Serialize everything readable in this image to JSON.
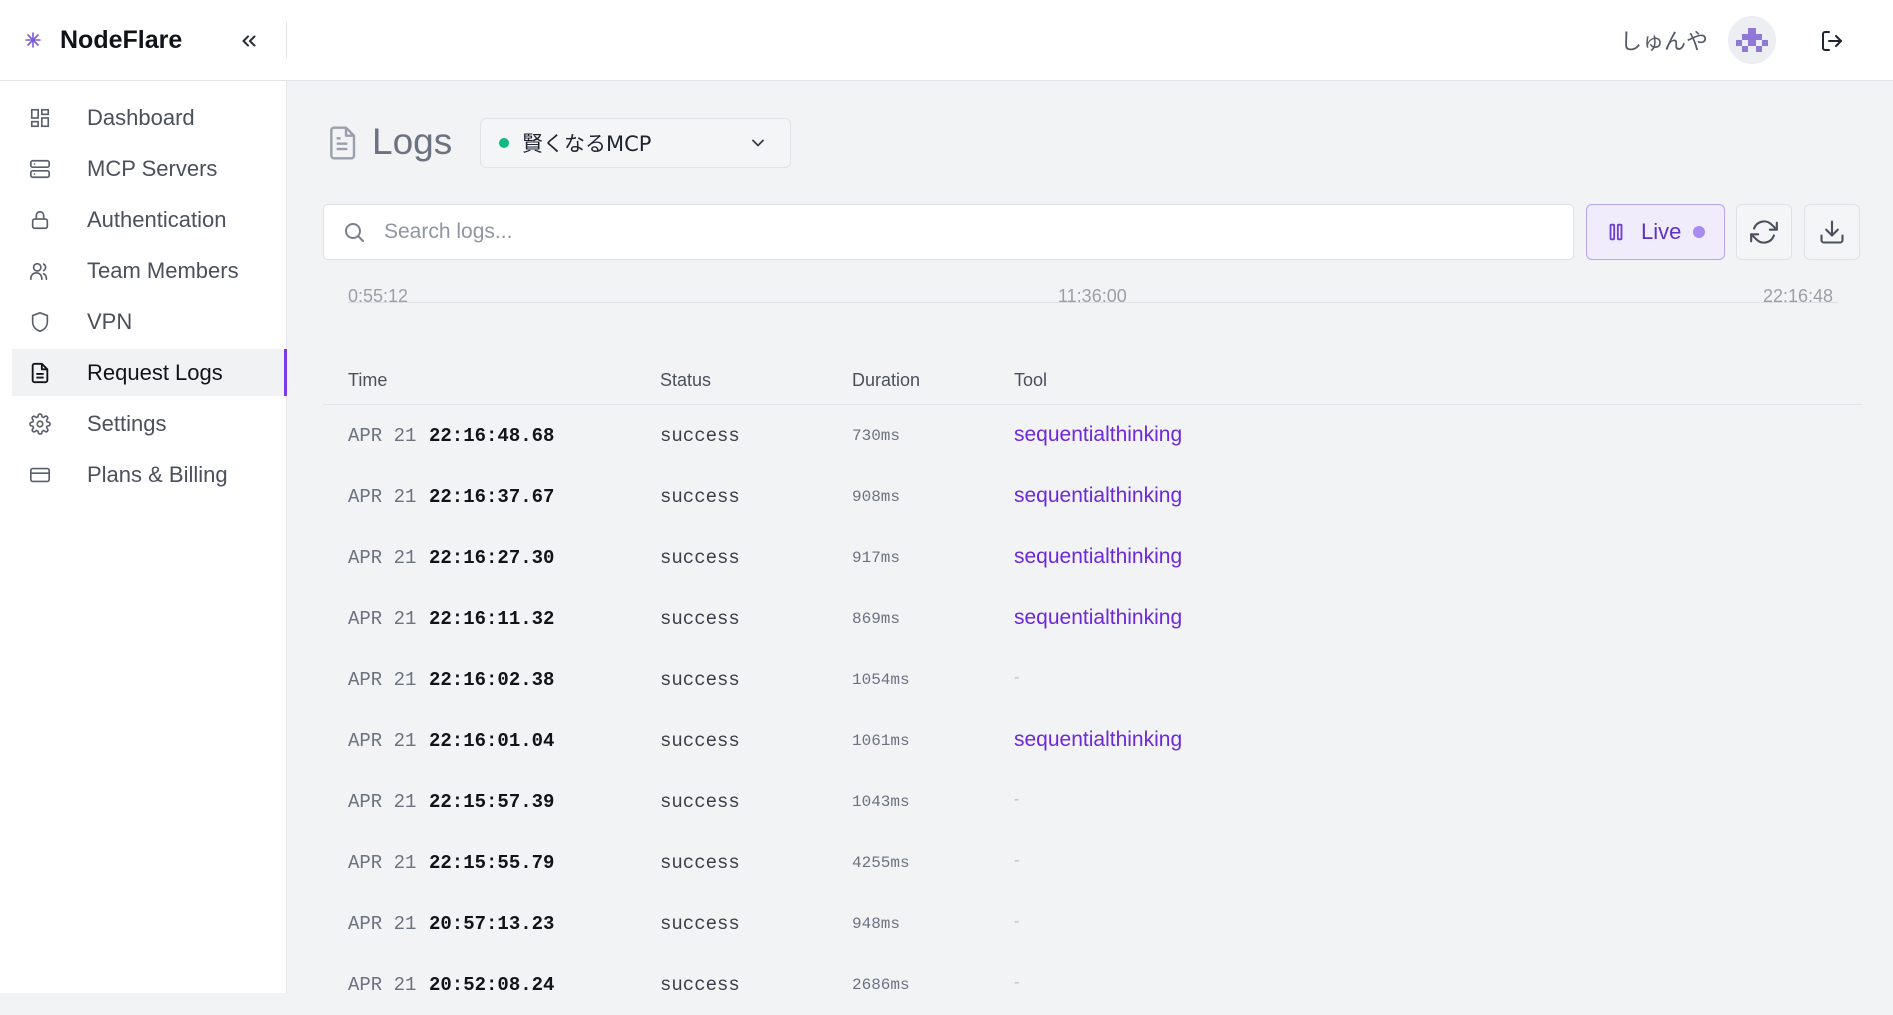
{
  "app": {
    "brand": "NodeFlare",
    "user_name": "しゅんや"
  },
  "sidebar": {
    "items": [
      {
        "label": "Dashboard",
        "icon": "dashboard-icon"
      },
      {
        "label": "MCP Servers",
        "icon": "server-icon"
      },
      {
        "label": "Authentication",
        "icon": "lock-icon"
      },
      {
        "label": "Team Members",
        "icon": "users-icon"
      },
      {
        "label": "VPN",
        "icon": "shield-icon"
      },
      {
        "label": "Request Logs",
        "icon": "file-text-icon",
        "active": true
      },
      {
        "label": "Settings",
        "icon": "gear-icon"
      },
      {
        "label": "Plans & Billing",
        "icon": "credit-card-icon"
      }
    ]
  },
  "page": {
    "title": "Logs",
    "server_selector": {
      "value": "賢くなるMCP",
      "status_color": "#10b981"
    }
  },
  "search": {
    "placeholder": "Search logs...",
    "value": ""
  },
  "live": {
    "label": "Live",
    "accent": "#7c3aed"
  },
  "timeline": {
    "start": "0:55:12",
    "mid": "11:36:00",
    "end": "22:16:48"
  },
  "table": {
    "headers": {
      "time": "Time",
      "status": "Status",
      "duration": "Duration",
      "tool": "Tool"
    },
    "rows": [
      {
        "date": "APR 21",
        "time": "22:16:48.68",
        "status": "success",
        "duration": "730ms",
        "tool": "sequentialthinking"
      },
      {
        "date": "APR 21",
        "time": "22:16:37.67",
        "status": "success",
        "duration": "908ms",
        "tool": "sequentialthinking"
      },
      {
        "date": "APR 21",
        "time": "22:16:27.30",
        "status": "success",
        "duration": "917ms",
        "tool": "sequentialthinking"
      },
      {
        "date": "APR 21",
        "time": "22:16:11.32",
        "status": "success",
        "duration": "869ms",
        "tool": "sequentialthinking"
      },
      {
        "date": "APR 21",
        "time": "22:16:02.38",
        "status": "success",
        "duration": "1054ms",
        "tool": "-"
      },
      {
        "date": "APR 21",
        "time": "22:16:01.04",
        "status": "success",
        "duration": "1061ms",
        "tool": "sequentialthinking"
      },
      {
        "date": "APR 21",
        "time": "22:15:57.39",
        "status": "success",
        "duration": "1043ms",
        "tool": "-"
      },
      {
        "date": "APR 21",
        "time": "22:15:55.79",
        "status": "success",
        "duration": "4255ms",
        "tool": "-"
      },
      {
        "date": "APR 21",
        "time": "20:57:13.23",
        "status": "success",
        "duration": "948ms",
        "tool": "-"
      },
      {
        "date": "APR 21",
        "time": "20:52:08.24",
        "status": "success",
        "duration": "2686ms",
        "tool": "-"
      }
    ]
  }
}
